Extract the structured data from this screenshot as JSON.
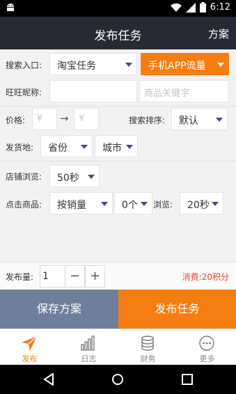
{
  "status": {
    "time": "6:12"
  },
  "header": {
    "title": "发布任务",
    "right_action": "方案"
  },
  "form": {
    "search_entry": {
      "label": "搜索入口:",
      "value": "淘宝任务",
      "mode": "手机APP流量"
    },
    "wangwang": {
      "label": "旺旺昵称:",
      "nick_placeholder": "",
      "keyword_placeholder": "商品关键字"
    },
    "price": {
      "label": "价格:",
      "min_placeholder": "¥",
      "arrow": "→",
      "max_placeholder": "¥"
    },
    "sort": {
      "label": "搜索排序:",
      "value": "默认"
    },
    "shipping": {
      "label": "发货地:",
      "province": "省份",
      "city": "城市"
    },
    "shop_browse": {
      "label": "店铺浏览:",
      "value": "50秒"
    },
    "click_goods": {
      "label": "点击商品:",
      "mode": "按销量",
      "count": "0个",
      "browse_label": "浏览:",
      "browse_value": "20秒"
    }
  },
  "quantity": {
    "label": "发布量:",
    "value": "1",
    "minus": "−",
    "plus": "+",
    "cost": "消费:20积分"
  },
  "actions": {
    "save": "保存方案",
    "publish": "发布任务"
  },
  "tabs": [
    {
      "label": "发布",
      "icon": "paper-plane-icon",
      "active": true
    },
    {
      "label": "日志",
      "icon": "bar-chart-icon",
      "active": false
    },
    {
      "label": "财务",
      "icon": "database-icon",
      "active": false
    },
    {
      "label": "更多",
      "icon": "more-icon",
      "active": false
    }
  ],
  "colors": {
    "accent": "#f57d12",
    "header": "#252a34",
    "save_button": "#6f7f9b",
    "cost_text": "#e8452f"
  }
}
